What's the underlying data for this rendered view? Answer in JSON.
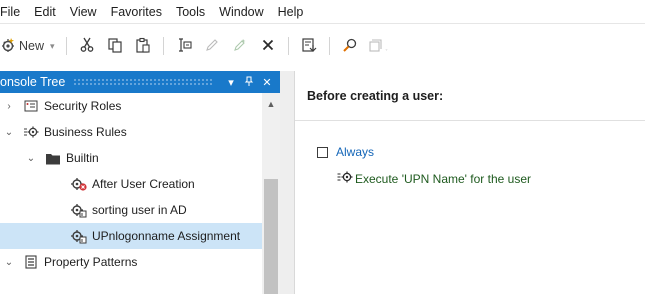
{
  "menubar": {
    "items": [
      "File",
      "Edit",
      "View",
      "Favorites",
      "Tools",
      "Window",
      "Help"
    ]
  },
  "toolbar": {
    "new_label": "New",
    "buttons": [
      "new-icon",
      "cut-icon",
      "copy-icon",
      "paste-icon",
      "rename-icon",
      "edit-icon",
      "properties-icon",
      "delete-icon",
      "export-icon",
      "search-icon",
      "window-icon"
    ]
  },
  "console_tree": {
    "title": "onsole Tree",
    "controls": [
      "▾",
      "ᵖ",
      "✕"
    ],
    "items": [
      {
        "label": "Security Roles",
        "icon": "security-roles-icon",
        "expanded": false
      },
      {
        "label": "Business Rules",
        "icon": "business-rules-icon",
        "expanded": true
      },
      {
        "label": "Builtin",
        "icon": "folder-icon",
        "expanded": true
      },
      {
        "label": "After User Creation",
        "icon": "rule-disabled-icon"
      },
      {
        "label": "sorting user in AD",
        "icon": "rule-icon"
      },
      {
        "label": "UPnlogonname Assignment",
        "icon": "rule-icon",
        "selected": true
      },
      {
        "label": "Property Patterns",
        "icon": "property-patterns-icon",
        "expanded": true
      }
    ]
  },
  "detail": {
    "header": "Before creating a user:",
    "condition_label": "Always",
    "action_text": "Execute 'UPN Name' for the user"
  },
  "colors": {
    "pane_header": "#1979ca",
    "selection": "#cce4f7",
    "link": "#1466b8",
    "action": "#1e5a1e"
  }
}
